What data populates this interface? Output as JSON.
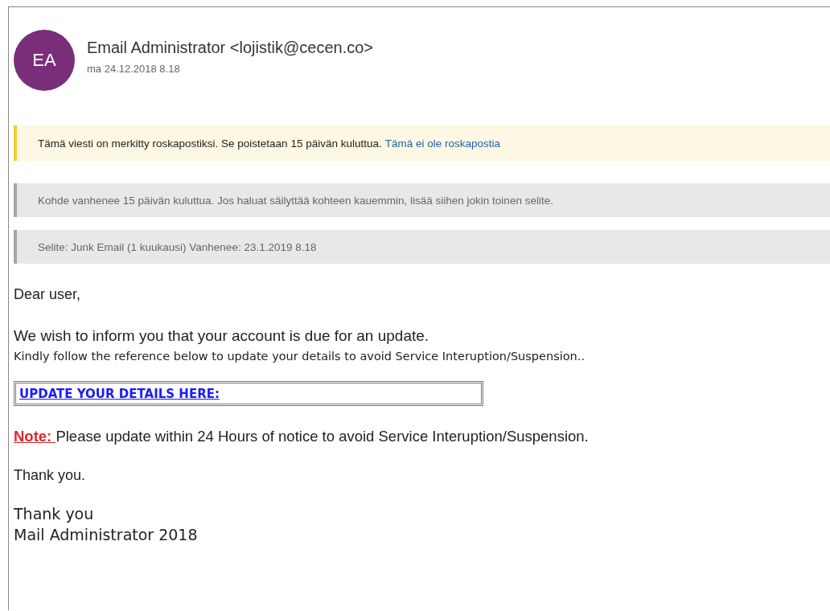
{
  "sender": {
    "initials": "EA",
    "name": "Email Administrator <lojistik@cecen.co>",
    "date": "ma 24.12.2018 8.18"
  },
  "banners": [
    {
      "kind": "junk",
      "text": "Tämä viesti on merkitty roskapostiksi. Se poistetaan 15 päivän kuluttua.",
      "link": "Tämä ei ole roskapostia"
    },
    {
      "kind": "info",
      "text": "Kohde vanhenee 15 päivän kuluttua. Jos haluat säilyttää kohteen kauemmin, lisää siihen jokin toinen selite."
    },
    {
      "kind": "info",
      "text": "Selite: Junk Email (1 kuukausi) Vanhenee: 23.1.2019 8.18"
    }
  ],
  "body": {
    "greeting": "Dear user,",
    "intro": "We wish to inform you that your account is due for an update.",
    "instruction": "Kindly follow the reference below to update your details to avoid Service Interuption/Suspension..",
    "link": "UPDATE YOUR DETAILS HERE:",
    "note_label": "Note: ",
    "note_text": "Please update within 24 Hours of notice to avoid Service Interuption/Suspension.",
    "thanks": "Thank you.",
    "signature": [
      "Thank you",
      "Mail Administrator 2018"
    ]
  }
}
